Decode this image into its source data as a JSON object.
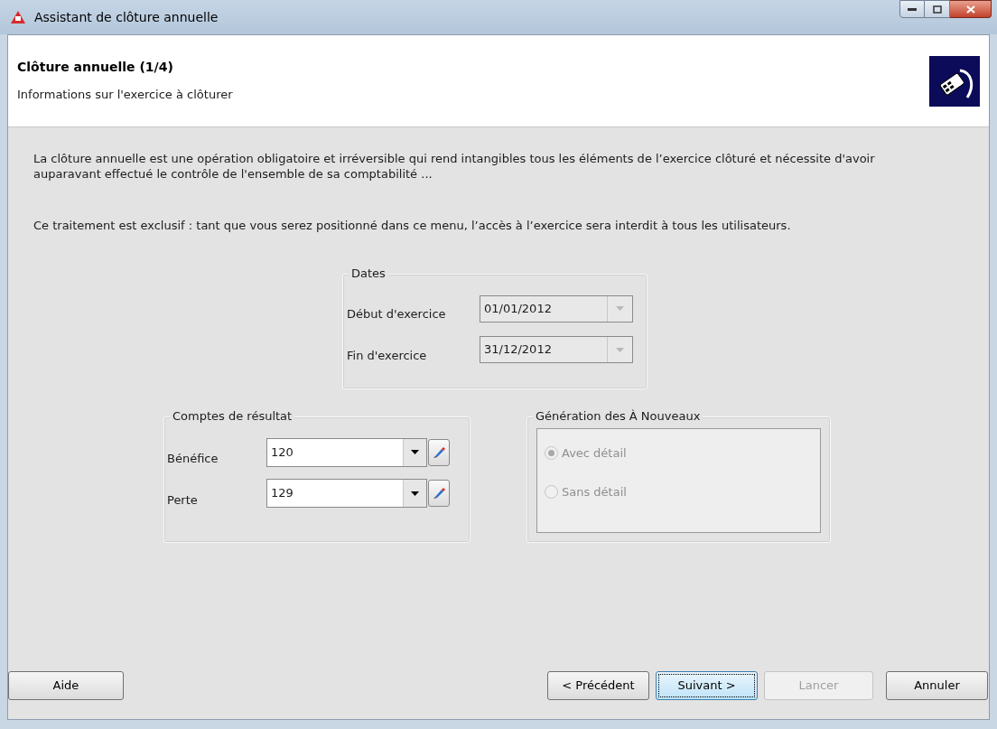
{
  "window": {
    "title": "Assistant de clôture annuelle"
  },
  "header": {
    "title": "Clôture annuelle (1/4)",
    "subtitle": "Informations sur l'exercice à clôturer"
  },
  "paragraphs": [
    "La clôture annuelle est une opération obligatoire et irréversible qui rend intangibles tous les éléments de l’exercice clôturé et nécessite d'avoir auparavant effectué le contrôle de l'ensemble de sa comptabilité ...",
    "Ce traitement est exclusif : tant que vous serez positionné dans ce menu, l’accès à l’exercice sera interdit à tous les utilisateurs."
  ],
  "dates": {
    "title": "Dates",
    "fields": [
      {
        "label": "Début d'exercice",
        "value": "01/01/2012",
        "disabled": true
      },
      {
        "label": "Fin d'exercice",
        "value": "31/12/2012",
        "disabled": true
      }
    ]
  },
  "accounts": {
    "title": "Comptes de résultat",
    "fields": [
      {
        "label": "Bénéfice",
        "value": "120",
        "disabled": false
      },
      {
        "label": "Perte",
        "value": "129",
        "disabled": false
      }
    ]
  },
  "generation": {
    "title": "Génération des À Nouveaux",
    "disabled": true,
    "options": [
      {
        "label": "Avec détail",
        "selected": true
      },
      {
        "label": "Sans détail",
        "selected": false
      }
    ]
  },
  "buttons": [
    {
      "label": "Aide",
      "disabled": false,
      "focused": false
    },
    {
      "label": "< Précédent",
      "disabled": false,
      "focused": false
    },
    {
      "label": "Suivant >",
      "disabled": false,
      "focused": true
    },
    {
      "label": "Lancer",
      "disabled": true,
      "focused": false
    },
    {
      "label": "Annuler",
      "disabled": false,
      "focused": false
    }
  ]
}
